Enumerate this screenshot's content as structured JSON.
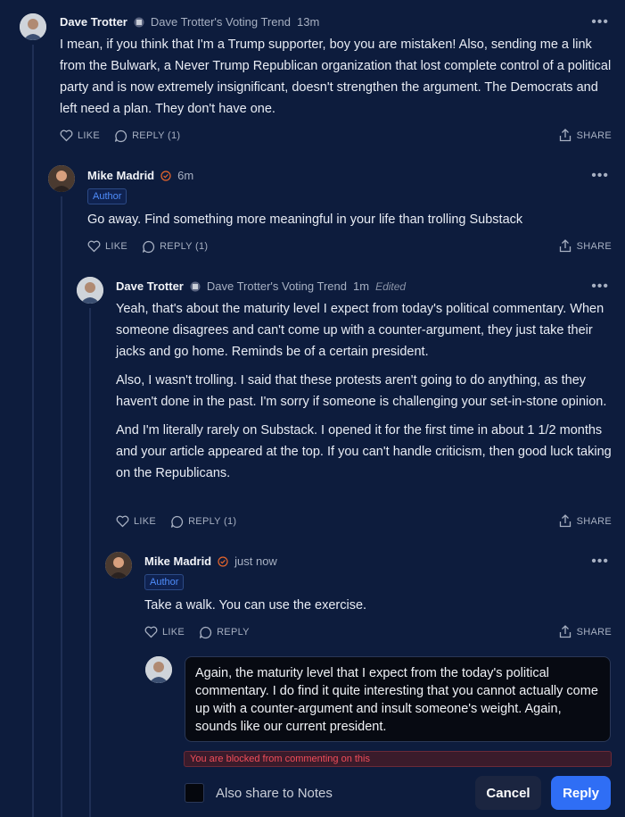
{
  "actions": {
    "like": "LIKE",
    "share": "SHARE",
    "more": "•••"
  },
  "comments": [
    {
      "name": "Dave Trotter",
      "publication": "Dave Trotter's Voting Trend",
      "time": "13m",
      "paragraphs": [
        "I mean, if you think that I'm a Trump supporter, boy you are mistaken! Also, sending me a link from the Bulwark, a Never Trump Republican organization that lost complete control of a political party and is now extremely insignificant, doesn't strengthen the argument. The Democrats and left need a plan. They don't have one."
      ],
      "reply_label": "REPLY (1)"
    },
    {
      "name": "Mike Madrid",
      "time": "6m",
      "author_tag": "Author",
      "paragraphs": [
        "Go away. Find something more meaningful in your life than trolling Substack"
      ],
      "reply_label": "REPLY (1)"
    },
    {
      "name": "Dave Trotter",
      "publication": "Dave Trotter's Voting Trend",
      "time": "1m",
      "edited": "Edited",
      "paragraphs": [
        "Yeah, that's about the maturity level I expect from today's political commentary. When someone disagrees and can't come up with a counter-argument, they just take their jacks and go home. Reminds be of a certain president.",
        "Also, I wasn't trolling. I said that these protests aren't going to do anything, as they haven't done in the past. I'm sorry if someone is challenging your set-in-stone opinion.",
        "And I'm literally rarely on Substack. I opened it for the first time in about 1 1/2 months and your article appeared at the top. If you can't handle criticism, then good luck taking on the Republicans."
      ],
      "reply_label": "REPLY (1)"
    },
    {
      "name": "Mike Madrid",
      "time": "just now",
      "author_tag": "Author",
      "paragraphs": [
        "Take a walk. You can use the exercise."
      ],
      "reply_label": "REPLY"
    }
  ],
  "composer": {
    "draft": "Again, the maturity level that I expect from the today's political commentary. I do find it quite interesting that you cannot actually come up with a counter-argument and insult someone's weight. Again, sounds like our current president.",
    "error": "You are blocked from commenting on this",
    "share_notes_label": "Also share to Notes",
    "cancel_label": "Cancel",
    "reply_label": "Reply"
  },
  "colors": {
    "background": "#0d1c3d",
    "accent": "#2f6ef5",
    "author_badge": "#e8662c",
    "error": "#f04d5a"
  }
}
